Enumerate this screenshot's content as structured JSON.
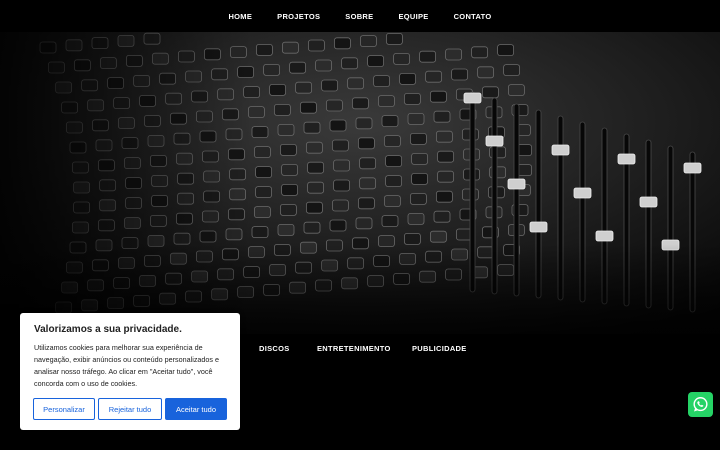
{
  "nav": {
    "items": [
      "HOME",
      "PROJETOS",
      "SOBRE",
      "EQUIPE",
      "CONTATO"
    ]
  },
  "hero": {
    "image": "mixing-console-photo"
  },
  "categories": {
    "items": [
      "DISCOS",
      "ENTRETENIMENTO",
      "PUBLICIDADE"
    ]
  },
  "cookie_banner": {
    "title": "Valorizamos a sua privacidade.",
    "text": "Utilizamos cookies para melhorar sua experiência de navegação, exibir anúncios ou conteúdo personalizados e analisar nosso tráfego. Ao clicar em \"Aceitar tudo\", você concorda com o uso de cookies.",
    "customize_label": "Personalizar",
    "reject_label": "Rejeitar tudo",
    "accept_label": "Aceitar tudo"
  },
  "whatsapp": {
    "icon": "whatsapp-icon"
  },
  "colors": {
    "accent": "#1863dc",
    "whatsapp": "#25d366",
    "background": "#000000"
  }
}
